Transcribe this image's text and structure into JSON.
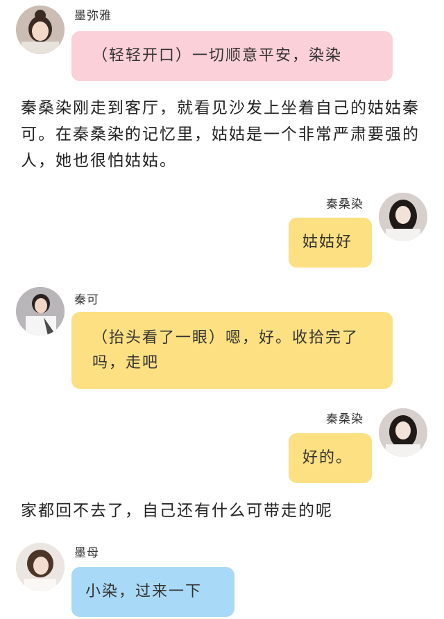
{
  "messages": [
    {
      "speaker": "墨弥雅",
      "text": "（轻轻开口）一切顺意平安，染染",
      "bubble_color": "#fbd0d8",
      "side": "left"
    },
    {
      "narration": "秦桑染刚走到客厅，就看见沙发上坐着自己的姑姑秦可。在秦桑染的记忆里，姑姑是一个非常严肃要强的人，她也很怕姑姑。"
    },
    {
      "speaker": "秦桑染",
      "text": "姑姑好",
      "bubble_color": "#fde082",
      "side": "right"
    },
    {
      "speaker": "秦可",
      "text": "（抬头看了一眼）嗯，好。收拾完了吗，走吧",
      "bubble_color": "#fde082",
      "side": "left"
    },
    {
      "speaker": "秦桑染",
      "text": "好的。",
      "bubble_color": "#fde082",
      "side": "right"
    },
    {
      "narration": "家都回不去了，自己还有什么可带走的呢"
    },
    {
      "speaker": "墨母",
      "text": "小染，过来一下",
      "bubble_color": "#a8daf7",
      "side": "left"
    }
  ]
}
